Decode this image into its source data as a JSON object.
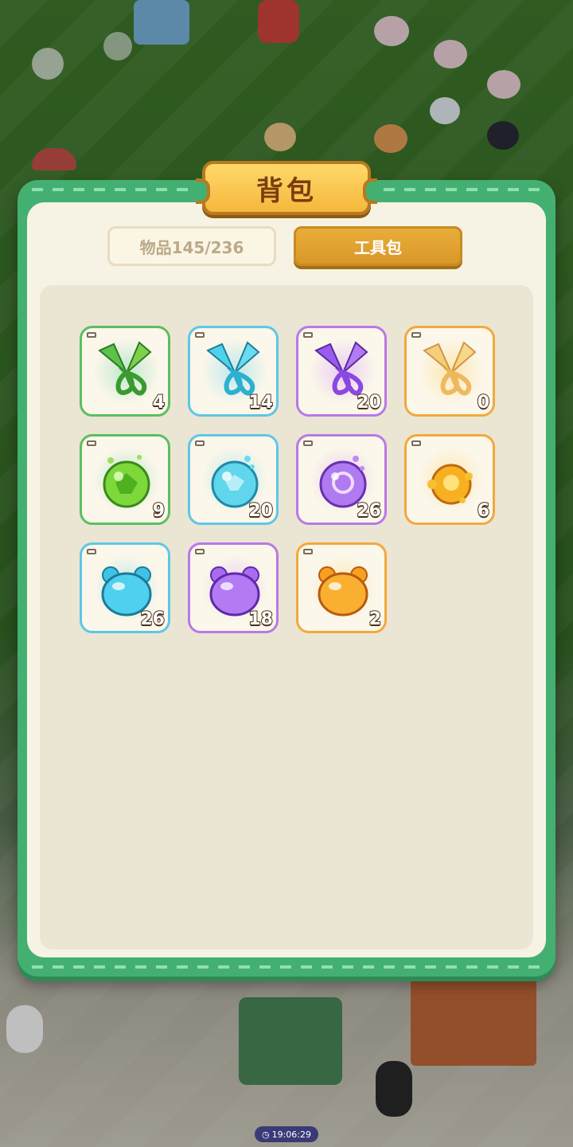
{
  "panel": {
    "title": "背包"
  },
  "tabs": [
    {
      "label": "物品145/236",
      "active": false
    },
    {
      "label": "工具包",
      "active": true
    }
  ],
  "items": [
    {
      "icon": "scissors-icon",
      "rarity": "green",
      "count": "4"
    },
    {
      "icon": "scissors-icon",
      "rarity": "cyan",
      "count": "14"
    },
    {
      "icon": "scissors-icon",
      "rarity": "purple",
      "count": "20"
    },
    {
      "icon": "scissors-icon",
      "rarity": "orange",
      "count": "0"
    },
    {
      "icon": "fertilizer-orb-icon",
      "rarity": "green",
      "count": "9"
    },
    {
      "icon": "fertilizer-orb-icon",
      "rarity": "cyan",
      "count": "20"
    },
    {
      "icon": "fertilizer-orb-icon",
      "rarity": "purple",
      "count": "26"
    },
    {
      "icon": "fertilizer-orb-icon",
      "rarity": "orange",
      "count": "6"
    },
    {
      "icon": "bear-jelly-icon",
      "rarity": "cyan",
      "count": "26"
    },
    {
      "icon": "bear-jelly-icon",
      "rarity": "purple",
      "count": "18"
    },
    {
      "icon": "bear-jelly-icon",
      "rarity": "orange",
      "count": "2"
    }
  ],
  "colors": {
    "panel_green": "#43b071",
    "green": "#5bbf60",
    "cyan": "#5ec7e6",
    "purple": "#b879e6",
    "orange": "#f2a93c"
  },
  "status": {
    "time": "19:06:29"
  }
}
